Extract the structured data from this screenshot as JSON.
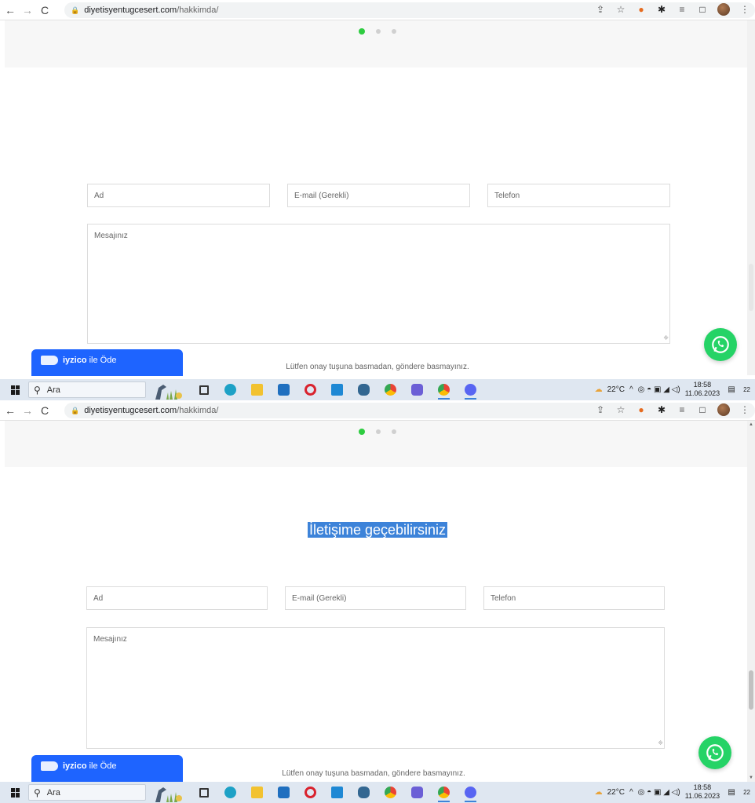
{
  "browser": {
    "url_host": "diyetisyentugcesert.com",
    "url_path": "/hakkimda/"
  },
  "page": {
    "title": "İletişime geçebilirsiniz",
    "form": {
      "name_placeholder": "Ad",
      "email_placeholder": "E-mail (Gerekli)",
      "phone_placeholder": "Telefon",
      "message_placeholder": "Mesajınız"
    },
    "note": "Lütfen onay tuşuna basmadan, göndere basmayınız.",
    "iyzico": {
      "brand": "iyzico",
      "label": "ile Öde"
    },
    "colors": {
      "accent": "#2ecc40",
      "whatsapp": "#25d366",
      "iyzico": "#1e64ff",
      "selection": "#3d83d9"
    }
  },
  "taskbar": {
    "search_label": "Ara",
    "weather": "22°C",
    "time": "18:58",
    "date": "11.06.2023",
    "notifications": "22"
  }
}
